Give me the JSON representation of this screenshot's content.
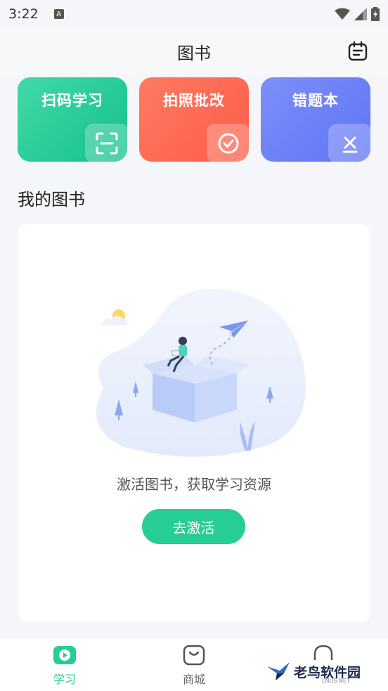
{
  "status_bar": {
    "time": "3:22",
    "notif_letter": "A"
  },
  "header": {
    "title": "图书"
  },
  "cards": [
    {
      "label": "扫码学习",
      "color": "#1fc893"
    },
    {
      "label": "拍照批改",
      "color": "#fe6650"
    },
    {
      "label": "错题本",
      "color": "#6b80f7"
    }
  ],
  "section_title": "我的图书",
  "empty_state": {
    "hint": "激活图书，获取学习资源",
    "button_label": "去激活"
  },
  "tabs": [
    {
      "label": "学习",
      "active": true
    },
    {
      "label": "商城",
      "active": false
    },
    {
      "label": "",
      "active": false
    }
  ],
  "watermark": {
    "text": "老鸟软件园",
    "sub": "LNUS.NET"
  },
  "colors": {
    "accent": "#26cd95",
    "background": "#f4f6f9"
  }
}
